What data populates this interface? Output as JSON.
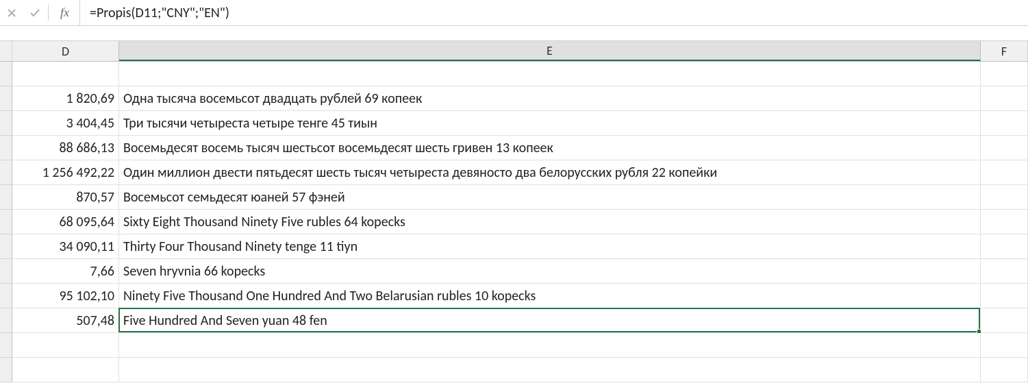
{
  "formula_bar": {
    "fx_label": "fx",
    "formula": "=Propis(D11;\"CNY\";\"EN\")"
  },
  "columns": {
    "D": "D",
    "E": "E",
    "F": "F"
  },
  "rows": [
    {
      "D": "",
      "E": ""
    },
    {
      "D": "1 820,69",
      "E": "Одна тысяча восемьсот двадцать рублей 69 копеек"
    },
    {
      "D": "3 404,45",
      "E": "Три тысячи четыреста четыре тенге 45 тиын"
    },
    {
      "D": "88 686,13",
      "E": "Восемьдесят восемь тысяч шестьсот восемьдесят шесть гривен 13 копеек"
    },
    {
      "D": "1 256 492,22",
      "E": "Один миллион двести пятьдесят шесть тысяч четыреста девяносто два белорусских рубля 22 копейки"
    },
    {
      "D": "870,57",
      "E": "Восемьсот семьдесят юаней 57 фэней"
    },
    {
      "D": "68 095,64",
      "E": "Sixty Eight Thousand Ninety Five rubles 64 kopecks"
    },
    {
      "D": "34 090,11",
      "E": "Thirty Four Thousand Ninety tenge 11 tiyn"
    },
    {
      "D": "7,66",
      "E": "Seven hryvnia 66 kopecks"
    },
    {
      "D": "95 102,10",
      "E": "Ninety Five Thousand One Hundred And Two Belarusian rubles 10 kopecks"
    },
    {
      "D": "507,48",
      "E": "Five Hundred And Seven yuan 48 fen"
    },
    {
      "D": "",
      "E": ""
    },
    {
      "D": "",
      "E": ""
    }
  ],
  "active": {
    "row_index": 10,
    "col": "E"
  }
}
